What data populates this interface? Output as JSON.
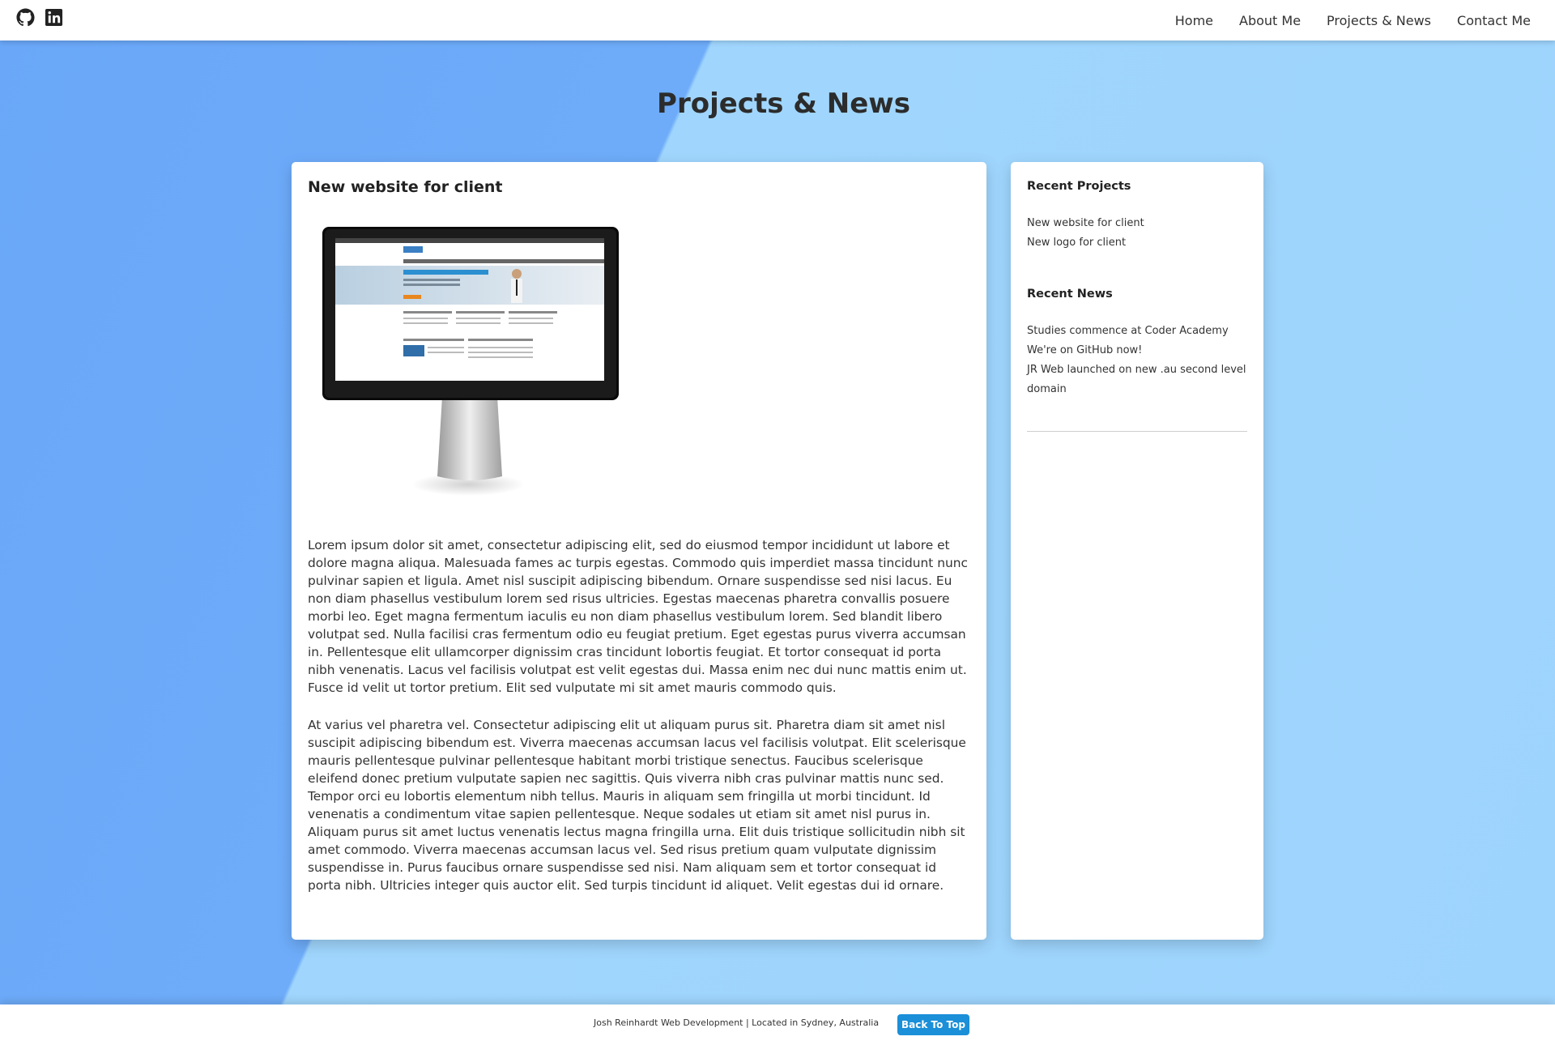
{
  "header": {
    "social_icons": [
      "github-icon",
      "linkedin-icon"
    ],
    "nav": [
      {
        "label": "Home"
      },
      {
        "label": "About Me"
      },
      {
        "label": "Projects & News"
      },
      {
        "label": "Contact Me"
      }
    ]
  },
  "page": {
    "title": "Projects & News"
  },
  "post": {
    "title": "New website for client",
    "image_icon": "monitor-website-image",
    "paragraphs": [
      "Lorem ipsum dolor sit amet, consectetur adipiscing elit, sed do eiusmod tempor incididunt ut labore et dolore magna aliqua. Malesuada fames ac turpis egestas. Commodo quis imperdiet massa tincidunt nunc pulvinar sapien et ligula. Amet nisl suscipit adipiscing bibendum. Ornare suspendisse sed nisi lacus. Eu non diam phasellus vestibulum lorem sed risus ultricies. Egestas maecenas pharetra convallis posuere morbi leo. Eget magna fermentum iaculis eu non diam phasellus vestibulum lorem. Sed blandit libero volutpat sed. Nulla facilisi cras fermentum odio eu feugiat pretium. Eget egestas purus viverra accumsan in. Pellentesque elit ullamcorper dignissim cras tincidunt lobortis feugiat. Et tortor consequat id porta nibh venenatis. Lacus vel facilisis volutpat est velit egestas dui. Massa enim nec dui nunc mattis enim ut. Fusce id velit ut tortor pretium. Elit sed vulputate mi sit amet mauris commodo quis.",
      "At varius vel pharetra vel. Consectetur adipiscing elit ut aliquam purus sit. Pharetra diam sit amet nisl suscipit adipiscing bibendum est. Viverra maecenas accumsan lacus vel facilisis volutpat. Elit scelerisque mauris pellentesque pulvinar pellentesque habitant morbi tristique senectus. Faucibus scelerisque eleifend donec pretium vulputate sapien nec sagittis. Quis viverra nibh cras pulvinar mattis nunc sed. Tempor orci eu lobortis elementum nibh tellus. Mauris in aliquam sem fringilla ut morbi tincidunt. Id venenatis a condimentum vitae sapien pellentesque. Neque sodales ut etiam sit amet nisl purus in. Aliquam purus sit amet luctus venenatis lectus magna fringilla urna. Elit duis tristique sollicitudin nibh sit amet commodo. Viverra maecenas accumsan lacus vel. Sed risus pretium quam vulputate dignissim suspendisse in. Purus faucibus ornare suspendisse sed nisi. Nam aliquam sem et tortor consequat id porta nibh. Ultricies integer quis auctor elit. Sed turpis tincidunt id aliquet. Velit egestas dui id ornare."
    ]
  },
  "sidebar": {
    "projects_heading": "Recent Projects",
    "projects": [
      {
        "label": "New website for client"
      },
      {
        "label": "New logo for client"
      }
    ],
    "news_heading": "Recent News",
    "news": [
      {
        "label": "Studies commence at Coder Academy"
      },
      {
        "label": "We're on GitHub now!"
      },
      {
        "label": "JR Web launched on new .au second level domain"
      }
    ]
  },
  "footer": {
    "text": "Josh Reinhardt Web Development | Located in Sydney, Australia",
    "back_to_top": "Back To Top"
  },
  "colors": {
    "background_light": "#9dd4fd",
    "background_dark": "#6eacf9",
    "button": "#1b8fd8"
  }
}
